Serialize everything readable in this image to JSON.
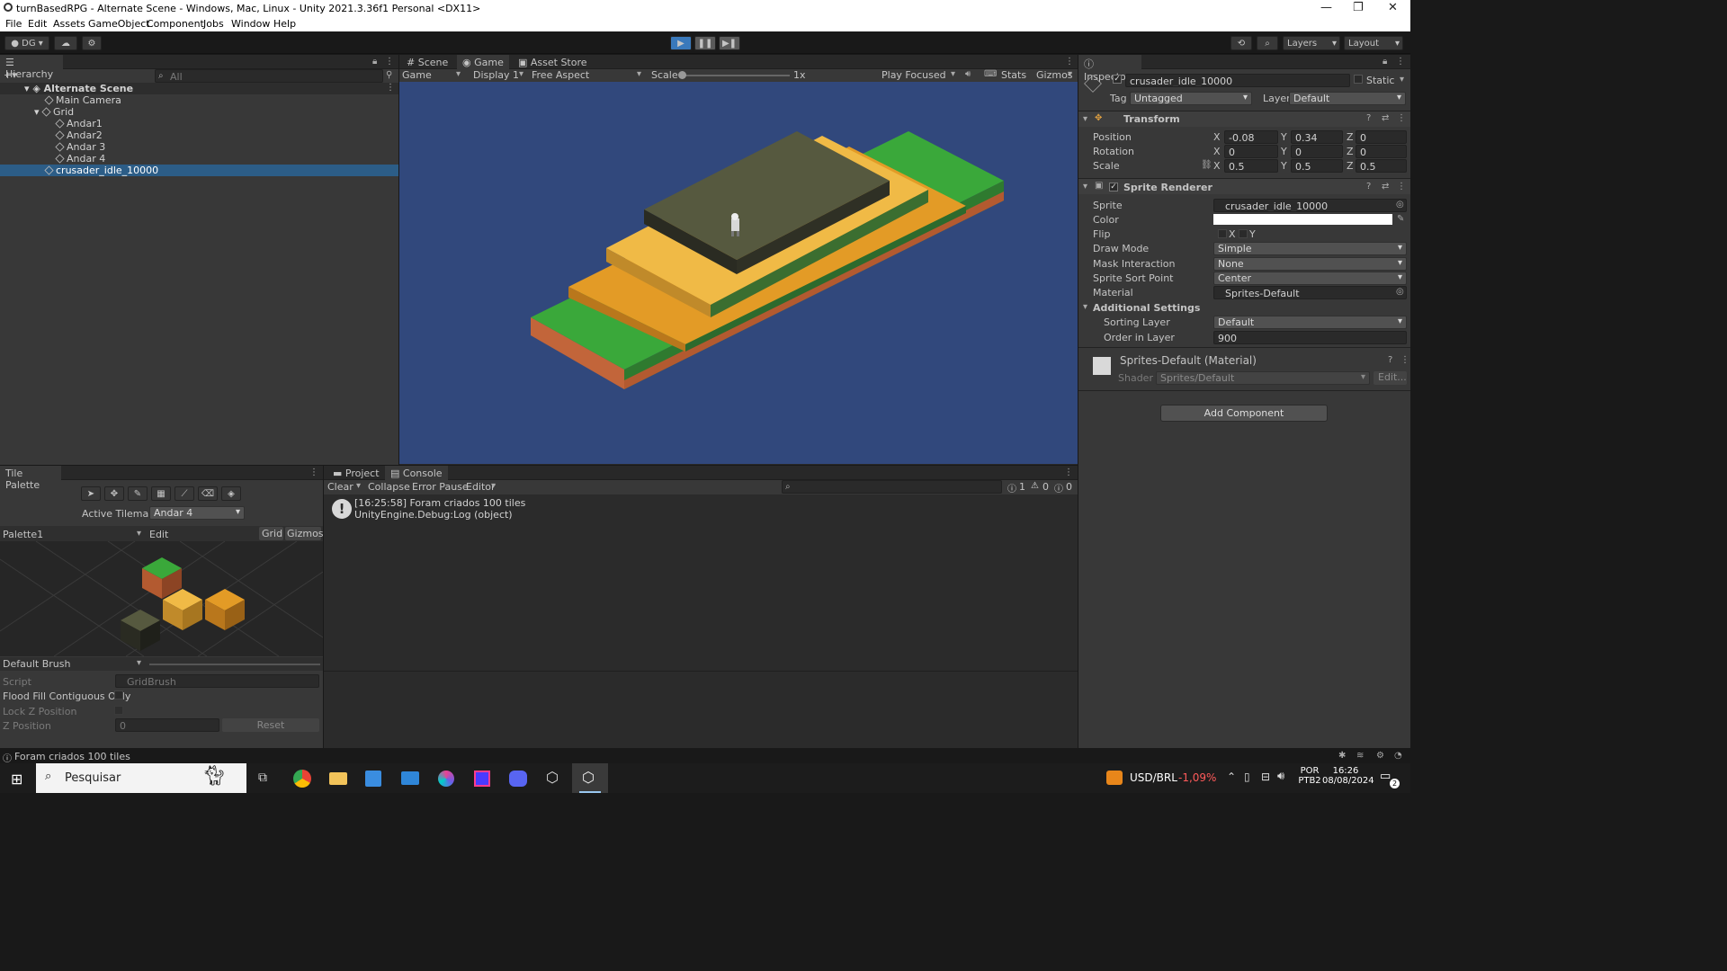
{
  "window": {
    "title": "turnBasedRPG - Alternate Scene - Windows, Mac, Linux - Unity 2021.3.36f1 Personal <DX11>"
  },
  "menu": [
    "File",
    "Edit",
    "Assets",
    "GameObject",
    "Component",
    "Jobs",
    "Window",
    "Help"
  ],
  "toolbar": {
    "account": "DG",
    "layers": "Layers",
    "layout": "Layout"
  },
  "hierarchy": {
    "tab": "Hierarchy",
    "search_placeholder": "All",
    "items": [
      "Alternate Scene",
      "Main Camera",
      "Grid",
      "Andar1",
      "Andar2",
      "Andar 3",
      "Andar 4",
      "crusader_idle_10000"
    ]
  },
  "scene": {
    "tabs": [
      "Scene",
      "Game",
      "Asset Store"
    ],
    "game_dropdown": "Game",
    "display": "Display 1",
    "aspect": "Free Aspect",
    "scale_label": "Scale",
    "scale_value": "1x",
    "play_focused": "Play Focused",
    "stats": "Stats",
    "gizmos": "Gizmos"
  },
  "inspector": {
    "tab": "Inspector",
    "object_name": "crusader_idle_10000",
    "static": "Static",
    "tag_label": "Tag",
    "tag": "Untagged",
    "layer_label": "Layer",
    "layer": "Default",
    "transform": {
      "title": "Transform",
      "position_label": "Position",
      "px": "-0.08",
      "py": "0.34",
      "pz": "0",
      "rotation_label": "Rotation",
      "rx": "0",
      "ry": "0",
      "rz": "0",
      "scale_label": "Scale",
      "sx": "0.5",
      "sy": "0.5",
      "sz": "0.5"
    },
    "sprite_renderer": {
      "title": "Sprite Renderer",
      "sprite_label": "Sprite",
      "sprite": "crusader_idle_10000",
      "color_label": "Color",
      "flip_label": "Flip",
      "flip_x": "X",
      "flip_y": "Y",
      "draw_mode_label": "Draw Mode",
      "draw_mode": "Simple",
      "mask_label": "Mask Interaction",
      "mask": "None",
      "sort_point_label": "Sprite Sort Point",
      "sort_point": "Center",
      "material_label": "Material",
      "material": "Sprites-Default",
      "additional": "Additional Settings",
      "sorting_layer_label": "Sorting Layer",
      "sorting_layer": "Default",
      "order_label": "Order in Layer",
      "order": "900"
    },
    "material_block": {
      "title": "Sprites-Default (Material)",
      "shader_label": "Shader",
      "shader": "Sprites/Default",
      "edit": "Edit..."
    },
    "add_component": "Add Component",
    "axis": {
      "x": "X",
      "y": "Y",
      "z": "Z"
    }
  },
  "tile_palette": {
    "tab": "Tile Palette",
    "active_tilemap_label": "Active Tilemap",
    "active_tilemap": "Andar 4",
    "palette": "Palette1",
    "edit": "Edit",
    "grid": "Grid",
    "gizmos": "Gizmos",
    "brush": "Default Brush",
    "script_label": "Script",
    "script": "GridBrush",
    "flood_label": "Flood Fill Contiguous Only",
    "lockz_label": "Lock Z Position",
    "zpos_label": "Z Position",
    "zpos": "0",
    "reset": "Reset"
  },
  "console": {
    "tabs": [
      "Project",
      "Console"
    ],
    "clear": "Clear",
    "collapse": "Collapse",
    "error_pause": "Error Pause",
    "editor": "Editor",
    "count_log": "1",
    "count_warn": "0",
    "count_err": "0",
    "log_line1": "[16:25:58] Foram criados 100 tiles",
    "log_line2": "UnityEngine.Debug:Log (object)"
  },
  "status": "Foram criados 100 tiles",
  "taskbar": {
    "search": "Pesquisar",
    "ticker": "USD/BRL",
    "change": "-1,09%",
    "lang1": "POR",
    "lang2": "PTB2",
    "time": "16:26",
    "date": "08/08/2024",
    "notif": "2"
  },
  "colors": {
    "accent": "#2c5d87",
    "scene_bg": "#31487c",
    "negative": "#ff5a5a"
  }
}
